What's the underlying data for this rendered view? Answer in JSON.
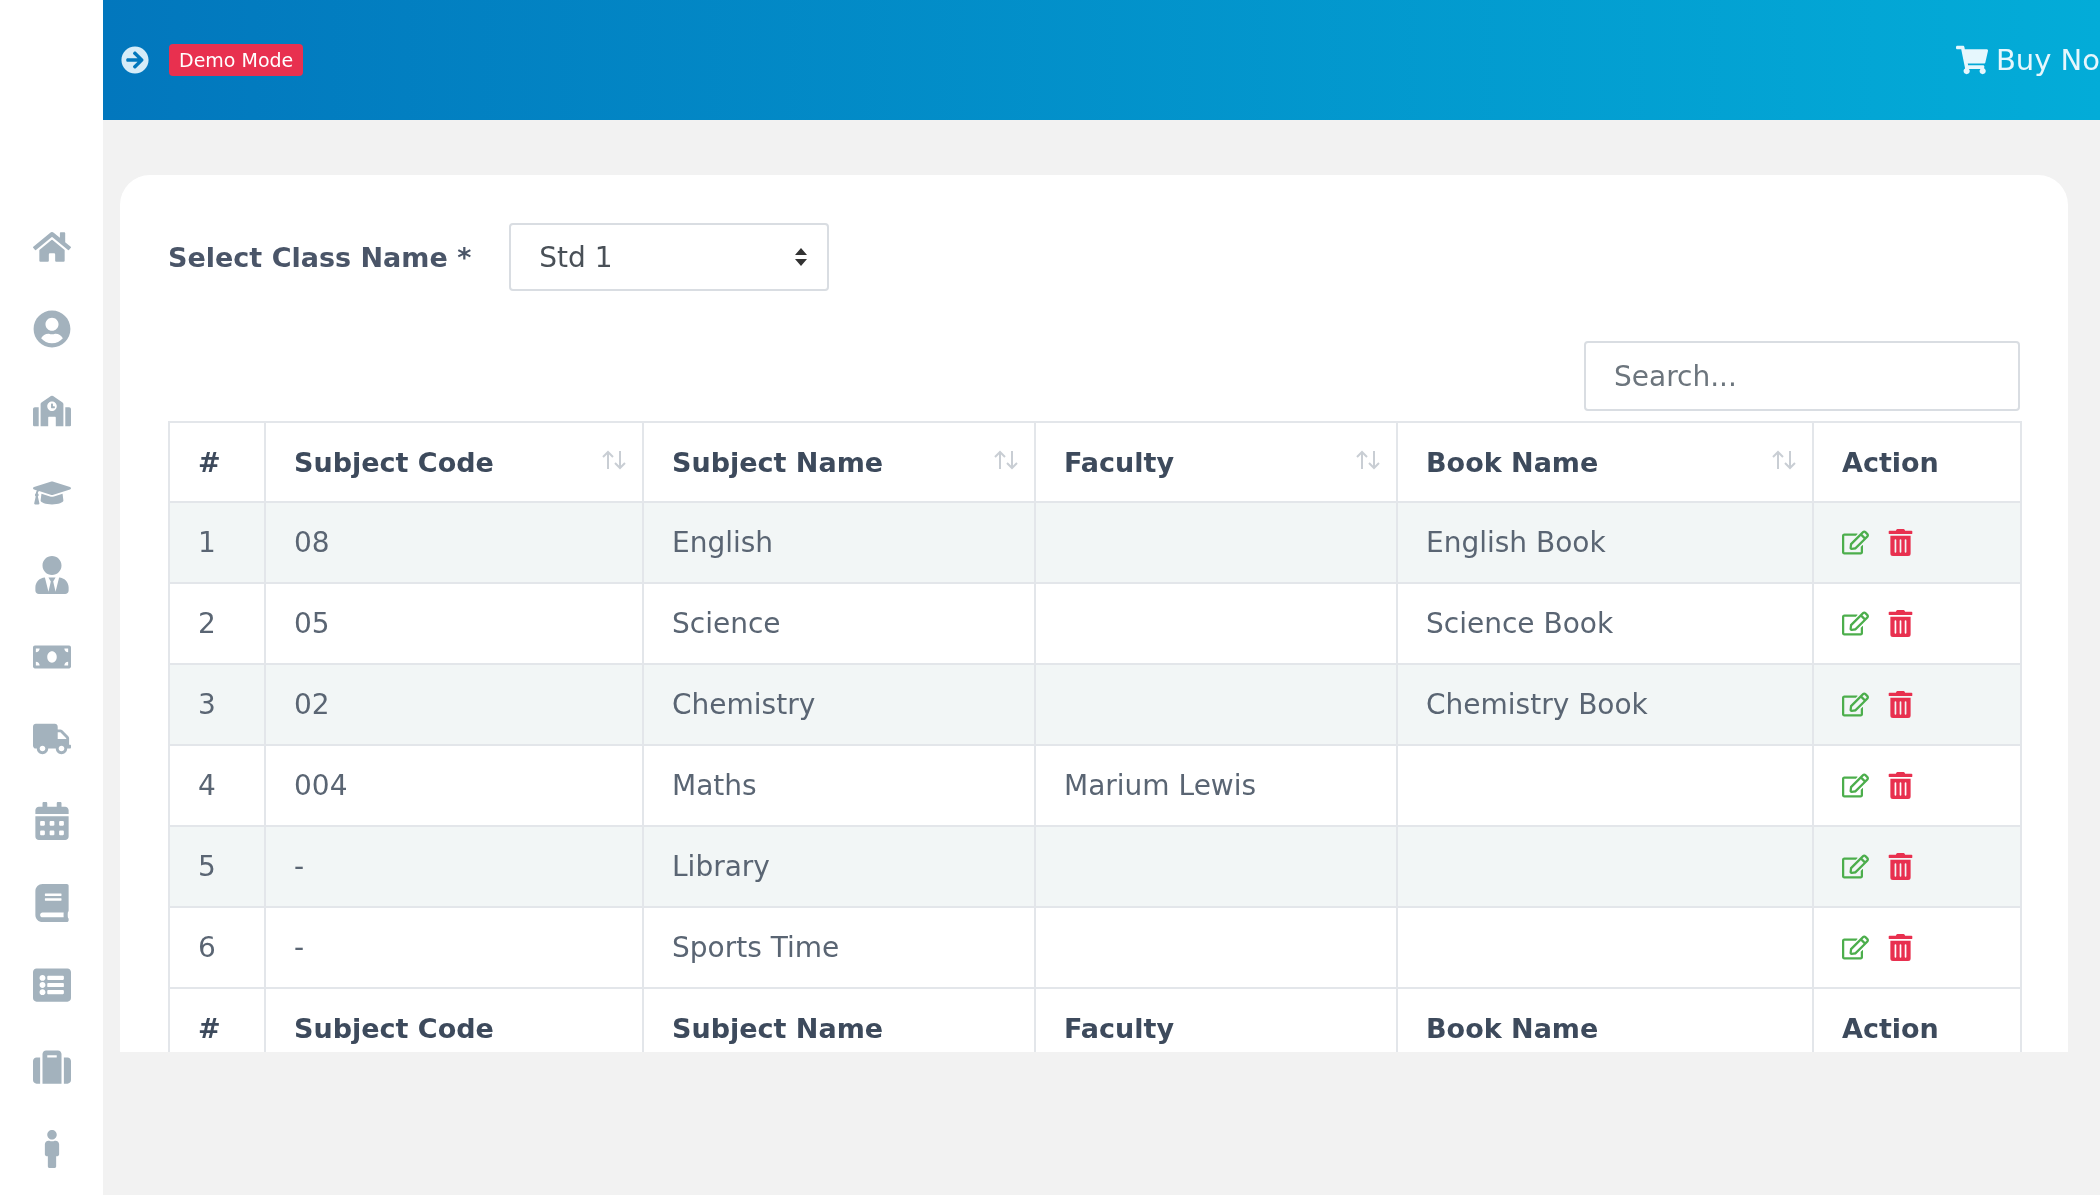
{
  "header": {
    "badge": "Demo Mode",
    "buy_link": "Buy No"
  },
  "sidebar": {
    "items": [
      {
        "kind": "home"
      },
      {
        "kind": "profile"
      },
      {
        "kind": "school"
      },
      {
        "kind": "graduation"
      },
      {
        "kind": "teacher"
      },
      {
        "kind": "money"
      },
      {
        "kind": "truck"
      },
      {
        "kind": "calendar"
      },
      {
        "kind": "book"
      },
      {
        "kind": "list"
      },
      {
        "kind": "briefcase"
      },
      {
        "kind": "person"
      }
    ]
  },
  "filter": {
    "label": "Select Class Name *",
    "value": "Std 1"
  },
  "search": {
    "placeholder": "Search..."
  },
  "table": {
    "columns": [
      {
        "label": "#",
        "sortable": false
      },
      {
        "label": "Subject Code",
        "sortable": true
      },
      {
        "label": "Subject Name",
        "sortable": true
      },
      {
        "label": "Faculty",
        "sortable": true
      },
      {
        "label": "Book Name",
        "sortable": true
      },
      {
        "label": "Action",
        "sortable": false
      }
    ],
    "rows": [
      [
        "1",
        "08",
        "English",
        "",
        "English Book"
      ],
      [
        "2",
        "05",
        "Science",
        "",
        "Science Book"
      ],
      [
        "3",
        "02",
        "Chemistry",
        "",
        "Chemistry Book"
      ],
      [
        "4",
        "004",
        "Maths",
        "Marium Lewis",
        ""
      ],
      [
        "5",
        "-",
        "Library",
        "",
        ""
      ],
      [
        "6",
        "-",
        "Sports Time",
        "",
        ""
      ]
    ],
    "footer": [
      "#",
      "Subject Code",
      "Subject Name",
      "Faculty",
      "Book Name",
      "Action"
    ]
  }
}
